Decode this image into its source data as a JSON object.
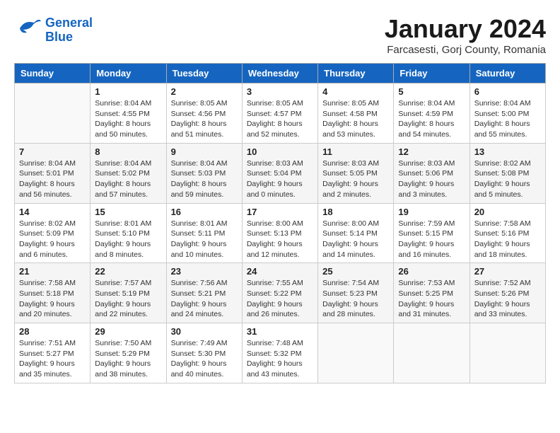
{
  "header": {
    "logo_line1": "General",
    "logo_line2": "Blue",
    "month_title": "January 2024",
    "subtitle": "Farcasesti, Gorj County, Romania"
  },
  "days_of_week": [
    "Sunday",
    "Monday",
    "Tuesday",
    "Wednesday",
    "Thursday",
    "Friday",
    "Saturday"
  ],
  "weeks": [
    [
      {
        "day": "",
        "info": ""
      },
      {
        "day": "1",
        "info": "Sunrise: 8:04 AM\nSunset: 4:55 PM\nDaylight: 8 hours\nand 50 minutes."
      },
      {
        "day": "2",
        "info": "Sunrise: 8:05 AM\nSunset: 4:56 PM\nDaylight: 8 hours\nand 51 minutes."
      },
      {
        "day": "3",
        "info": "Sunrise: 8:05 AM\nSunset: 4:57 PM\nDaylight: 8 hours\nand 52 minutes."
      },
      {
        "day": "4",
        "info": "Sunrise: 8:05 AM\nSunset: 4:58 PM\nDaylight: 8 hours\nand 53 minutes."
      },
      {
        "day": "5",
        "info": "Sunrise: 8:04 AM\nSunset: 4:59 PM\nDaylight: 8 hours\nand 54 minutes."
      },
      {
        "day": "6",
        "info": "Sunrise: 8:04 AM\nSunset: 5:00 PM\nDaylight: 8 hours\nand 55 minutes."
      }
    ],
    [
      {
        "day": "7",
        "info": "Sunrise: 8:04 AM\nSunset: 5:01 PM\nDaylight: 8 hours\nand 56 minutes."
      },
      {
        "day": "8",
        "info": "Sunrise: 8:04 AM\nSunset: 5:02 PM\nDaylight: 8 hours\nand 57 minutes."
      },
      {
        "day": "9",
        "info": "Sunrise: 8:04 AM\nSunset: 5:03 PM\nDaylight: 8 hours\nand 59 minutes."
      },
      {
        "day": "10",
        "info": "Sunrise: 8:03 AM\nSunset: 5:04 PM\nDaylight: 9 hours\nand 0 minutes."
      },
      {
        "day": "11",
        "info": "Sunrise: 8:03 AM\nSunset: 5:05 PM\nDaylight: 9 hours\nand 2 minutes."
      },
      {
        "day": "12",
        "info": "Sunrise: 8:03 AM\nSunset: 5:06 PM\nDaylight: 9 hours\nand 3 minutes."
      },
      {
        "day": "13",
        "info": "Sunrise: 8:02 AM\nSunset: 5:08 PM\nDaylight: 9 hours\nand 5 minutes."
      }
    ],
    [
      {
        "day": "14",
        "info": "Sunrise: 8:02 AM\nSunset: 5:09 PM\nDaylight: 9 hours\nand 6 minutes."
      },
      {
        "day": "15",
        "info": "Sunrise: 8:01 AM\nSunset: 5:10 PM\nDaylight: 9 hours\nand 8 minutes."
      },
      {
        "day": "16",
        "info": "Sunrise: 8:01 AM\nSunset: 5:11 PM\nDaylight: 9 hours\nand 10 minutes."
      },
      {
        "day": "17",
        "info": "Sunrise: 8:00 AM\nSunset: 5:13 PM\nDaylight: 9 hours\nand 12 minutes."
      },
      {
        "day": "18",
        "info": "Sunrise: 8:00 AM\nSunset: 5:14 PM\nDaylight: 9 hours\nand 14 minutes."
      },
      {
        "day": "19",
        "info": "Sunrise: 7:59 AM\nSunset: 5:15 PM\nDaylight: 9 hours\nand 16 minutes."
      },
      {
        "day": "20",
        "info": "Sunrise: 7:58 AM\nSunset: 5:16 PM\nDaylight: 9 hours\nand 18 minutes."
      }
    ],
    [
      {
        "day": "21",
        "info": "Sunrise: 7:58 AM\nSunset: 5:18 PM\nDaylight: 9 hours\nand 20 minutes."
      },
      {
        "day": "22",
        "info": "Sunrise: 7:57 AM\nSunset: 5:19 PM\nDaylight: 9 hours\nand 22 minutes."
      },
      {
        "day": "23",
        "info": "Sunrise: 7:56 AM\nSunset: 5:21 PM\nDaylight: 9 hours\nand 24 minutes."
      },
      {
        "day": "24",
        "info": "Sunrise: 7:55 AM\nSunset: 5:22 PM\nDaylight: 9 hours\nand 26 minutes."
      },
      {
        "day": "25",
        "info": "Sunrise: 7:54 AM\nSunset: 5:23 PM\nDaylight: 9 hours\nand 28 minutes."
      },
      {
        "day": "26",
        "info": "Sunrise: 7:53 AM\nSunset: 5:25 PM\nDaylight: 9 hours\nand 31 minutes."
      },
      {
        "day": "27",
        "info": "Sunrise: 7:52 AM\nSunset: 5:26 PM\nDaylight: 9 hours\nand 33 minutes."
      }
    ],
    [
      {
        "day": "28",
        "info": "Sunrise: 7:51 AM\nSunset: 5:27 PM\nDaylight: 9 hours\nand 35 minutes."
      },
      {
        "day": "29",
        "info": "Sunrise: 7:50 AM\nSunset: 5:29 PM\nDaylight: 9 hours\nand 38 minutes."
      },
      {
        "day": "30",
        "info": "Sunrise: 7:49 AM\nSunset: 5:30 PM\nDaylight: 9 hours\nand 40 minutes."
      },
      {
        "day": "31",
        "info": "Sunrise: 7:48 AM\nSunset: 5:32 PM\nDaylight: 9 hours\nand 43 minutes."
      },
      {
        "day": "",
        "info": ""
      },
      {
        "day": "",
        "info": ""
      },
      {
        "day": "",
        "info": ""
      }
    ]
  ]
}
